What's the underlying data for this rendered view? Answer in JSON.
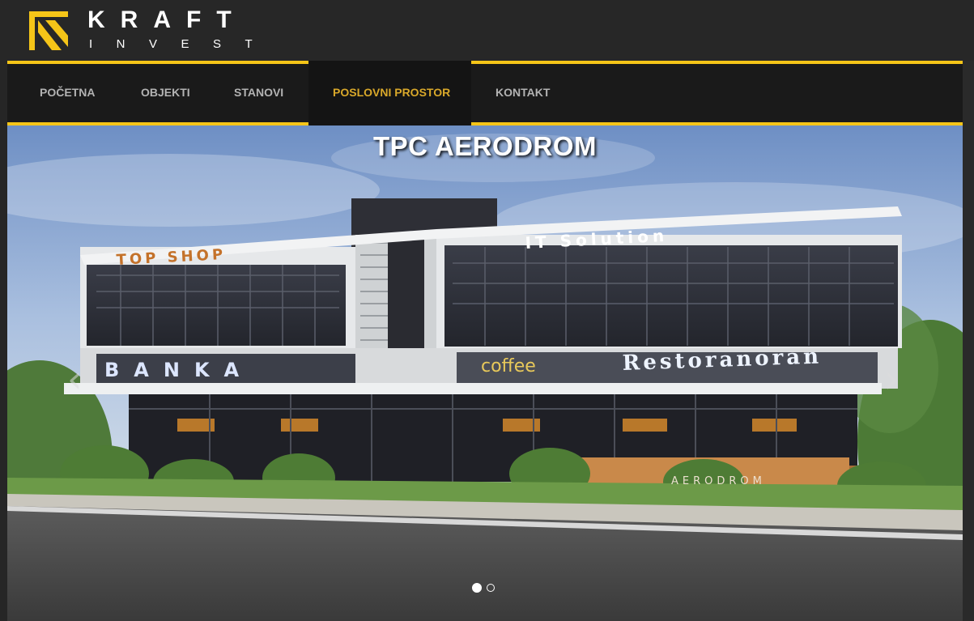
{
  "brand": {
    "name_line1": "KRAFT",
    "name_line2": "INVEST",
    "logo_icon": "kraft-invest-logo-icon",
    "accent_color": "#f5c518"
  },
  "nav": {
    "items": [
      {
        "label": "POČETNA",
        "active": false
      },
      {
        "label": "OBJEKTI",
        "active": false
      },
      {
        "label": "STANOVI",
        "active": false
      },
      {
        "label": "POSLOVNI PROSTOR",
        "active": true
      },
      {
        "label": "KONTAKT",
        "active": false
      }
    ]
  },
  "slider": {
    "title": "TPC AERODROM",
    "prev_icon": "chevron-left-icon",
    "next_icon": "chevron-right-icon",
    "slide_count": 2,
    "active_slide": 1,
    "building_signs": {
      "top_shop": "TOP SHOP",
      "it_solution": "IT Solution",
      "banka": "BANKA",
      "coffee": "coffee",
      "restoran": "Restoranoran",
      "aerodrom": "AERODROM"
    }
  }
}
